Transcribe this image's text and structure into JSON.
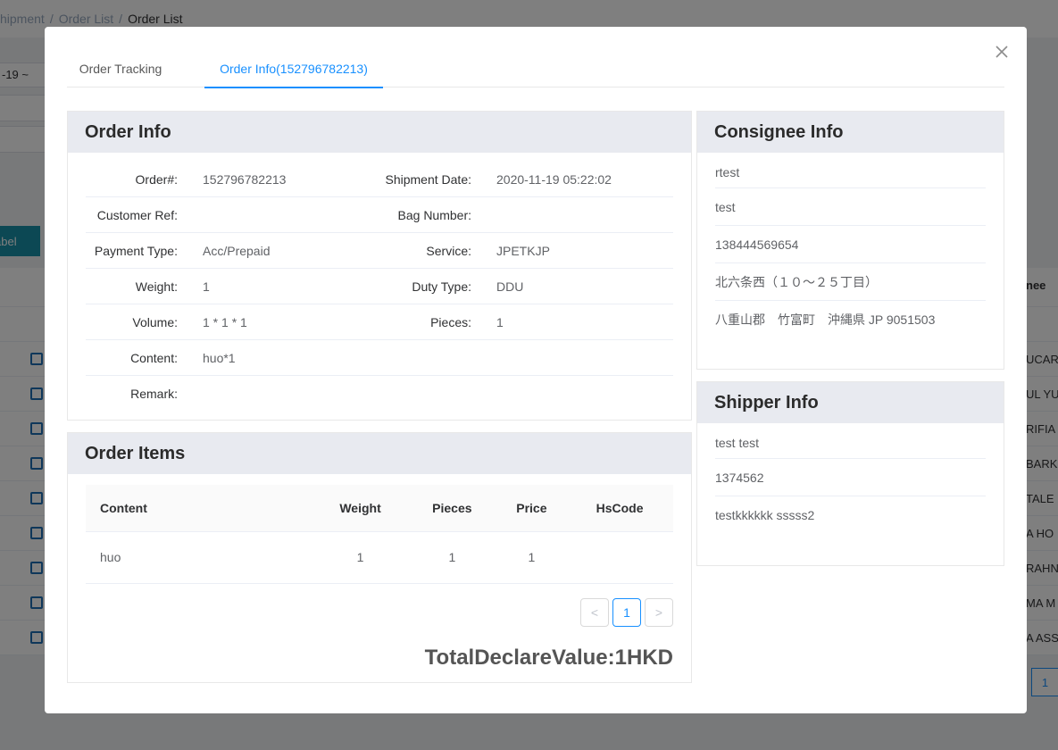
{
  "background": {
    "breadcrumb": [
      "hipment",
      "/",
      "Order List",
      "/",
      "Order List"
    ],
    "date_fragment": "-19  ~",
    "label_button": "abel",
    "right_column_header": "nee",
    "right_column_values": [
      "UCAR",
      "UL YU",
      "RIFIA",
      "BARK",
      "TALE",
      "A HO",
      "RAHN",
      "MA M",
      "A ASSE"
    ],
    "pager_current": "1"
  },
  "modal": {
    "tabs": [
      "Order Tracking",
      "Order Info(152796782213)"
    ],
    "active_tab": 1
  },
  "order_info": {
    "title": "Order Info",
    "rows": [
      {
        "l1": "Order#:",
        "v1": "152796782213",
        "l2": "Shipment Date:",
        "v2": "2020-11-19 05:22:02"
      },
      {
        "l1": "Customer Ref:",
        "v1": "",
        "l2": "Bag Number:",
        "v2": ""
      },
      {
        "l1": "Payment Type:",
        "v1": "Acc/Prepaid",
        "l2": "Service:",
        "v2": "JPETKJP"
      },
      {
        "l1": "Weight:",
        "v1": "1",
        "l2": "Duty Type:",
        "v2": "DDU"
      },
      {
        "l1": "Volume:",
        "v1": "1 * 1 * 1",
        "l2": "Pieces:",
        "v2": "1"
      },
      {
        "l1": "Content:",
        "v1": "huo*1",
        "l2": "",
        "v2": ""
      },
      {
        "l1": "Remark:",
        "v1": "",
        "l2": "",
        "v2": ""
      }
    ]
  },
  "order_items": {
    "title": "Order Items",
    "columns": [
      "Content",
      "Weight",
      "Pieces",
      "Price",
      "HsCode"
    ],
    "rows": [
      [
        "huo",
        "1",
        "1",
        "1",
        ""
      ]
    ],
    "pager": {
      "prev": "<",
      "current": "1",
      "next": ">"
    },
    "total": "TotalDeclareValue:1HKD"
  },
  "consignee": {
    "title": "Consignee Info",
    "lines": [
      "rtest",
      "test",
      "138444569654",
      "北六条西（１０～２５丁目）",
      "八重山郡　竹富町　沖縄県  JP  9051503"
    ]
  },
  "shipper": {
    "title": "Shipper Info",
    "lines": [
      "test test",
      "1374562",
      "testkkkkkk sssss2"
    ]
  }
}
